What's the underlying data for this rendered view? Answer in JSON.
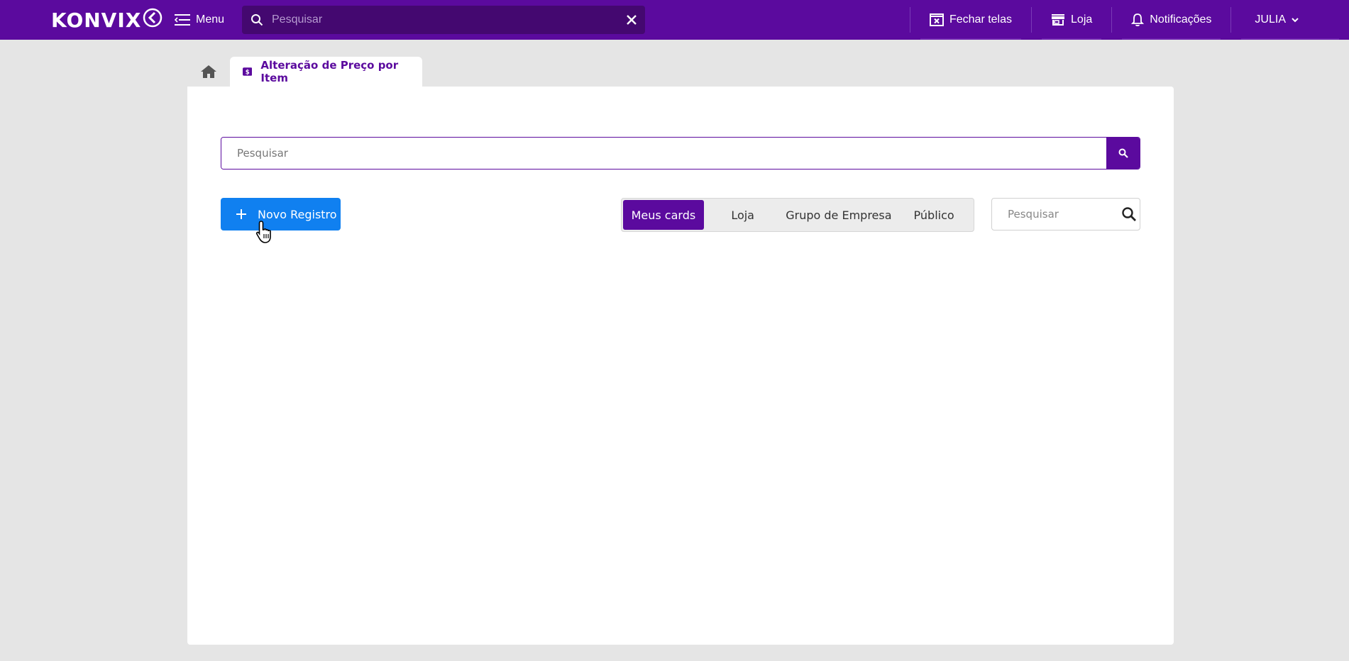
{
  "app": {
    "logo_text": "KONVIX"
  },
  "topbar": {
    "menu_label": "Menu",
    "search_placeholder": "Pesquisar",
    "close_screens_label": "Fechar telas",
    "store_label": "Loja",
    "notifications_label": "Notificações",
    "user_label": "JULIA"
  },
  "tabs": {
    "active_label": "Alteração de Preço por Item"
  },
  "main": {
    "search_placeholder": "Pesquisar",
    "new_record_label": "Novo Registro",
    "filters": [
      {
        "label": "Meus cards",
        "active": true
      },
      {
        "label": "Loja",
        "active": false
      },
      {
        "label": "Grupo de Empresa",
        "active": false
      },
      {
        "label": "Público",
        "active": false
      }
    ],
    "cards_search_placeholder": "Pesquisar"
  },
  "colors": {
    "brand": "#5b0a9e",
    "brand_dark": "#440870",
    "primary_button": "#1080f0",
    "background": "#e5e5e5"
  },
  "icons": {
    "menu": "hamburger-menu-icon",
    "search": "search-icon",
    "close": "close-icon",
    "close_screens": "close-window-icon",
    "store": "store-icon",
    "bell": "bell-icon",
    "chevron": "chevron-down-icon",
    "home": "home-icon",
    "tab": "price-tag-icon",
    "plus": "plus-icon"
  }
}
